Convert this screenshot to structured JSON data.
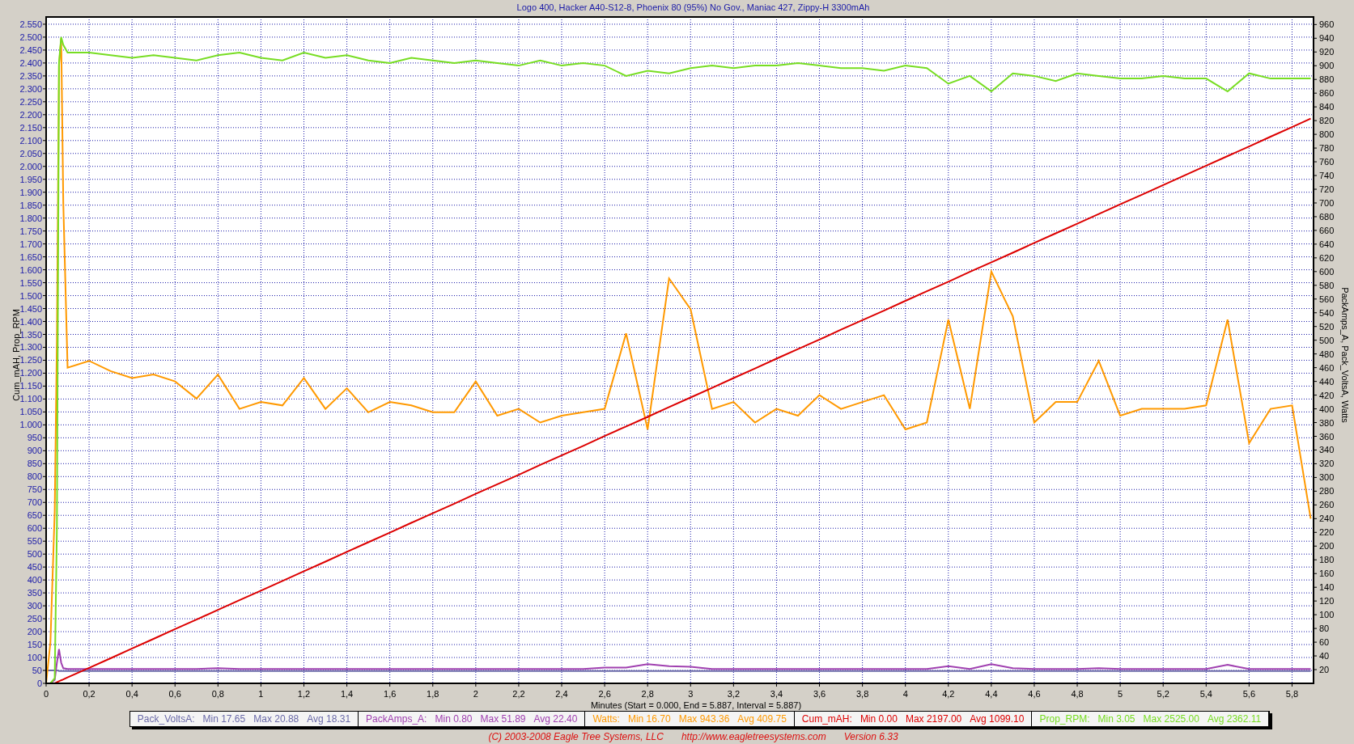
{
  "chart_data": {
    "type": "line",
    "title": "Logo 400, Hacker A40-S12-8, Phoenix 80 (95%) No Gov., Maniac 427, Zippy-H 3300mAh",
    "xlabel": "Minutes (Start = 0.000,  End = 5.887,  Interval =  5.887)",
    "ylabel": "Cum_mAH, Prop_RPM",
    "y2label": "PackAmps_A, Pack_VoltsA, Watts",
    "grid": true,
    "xlim": [
      0,
      5.9
    ],
    "ylim": [
      0,
      2578
    ],
    "y2lim": [
      0,
      971
    ],
    "x": [
      0,
      0.02,
      0.04,
      0.05,
      0.06,
      0.07,
      0.08,
      0.1,
      0.2,
      0.3,
      0.4,
      0.5,
      0.6,
      0.7,
      0.8,
      0.9,
      1.0,
      1.1,
      1.2,
      1.3,
      1.4,
      1.5,
      1.6,
      1.7,
      1.8,
      1.9,
      2.0,
      2.1,
      2.2,
      2.3,
      2.4,
      2.5,
      2.6,
      2.7,
      2.8,
      2.9,
      3.0,
      3.1,
      3.2,
      3.3,
      3.4,
      3.5,
      3.6,
      3.7,
      3.8,
      3.9,
      4.0,
      4.1,
      4.2,
      4.3,
      4.4,
      4.5,
      4.6,
      4.7,
      4.8,
      4.9,
      5.0,
      5.1,
      5.2,
      5.3,
      5.4,
      5.5,
      5.6,
      5.7,
      5.8,
      5.887
    ],
    "series": [
      {
        "name": "Pack_VoltsA:",
        "axis": "y2",
        "color": "#6a6aa8",
        "values": [
          19,
          19,
          19,
          19,
          18,
          18,
          18,
          18,
          18,
          18,
          18,
          18,
          18,
          18,
          18,
          18,
          18,
          18,
          18,
          18,
          18,
          18,
          18,
          18,
          18,
          18,
          18,
          18,
          18,
          18,
          18,
          18,
          18,
          18,
          18,
          18,
          18,
          18,
          18,
          18,
          18,
          18,
          18,
          18,
          18,
          18,
          18,
          18,
          18,
          18,
          18,
          18,
          18,
          18,
          18,
          18,
          18,
          18,
          18,
          18,
          18,
          18,
          18,
          18,
          18,
          18
        ]
      },
      {
        "name": "PackAmps_A:",
        "axis": "y2",
        "color": "#a040b0",
        "values": [
          0,
          0,
          5,
          30,
          50,
          30,
          22,
          21,
          21,
          21,
          21,
          21,
          21,
          21,
          22,
          21,
          21,
          21,
          21,
          21,
          21,
          21,
          21,
          21,
          21,
          21,
          21,
          21,
          21,
          21,
          21,
          21,
          23,
          23,
          28,
          25,
          24,
          21,
          21,
          21,
          21,
          21,
          21,
          21,
          21,
          21,
          21,
          21,
          25,
          21,
          28,
          22,
          21,
          21,
          21,
          22,
          21,
          21,
          21,
          21,
          21,
          27,
          21,
          21,
          21,
          21
        ]
      },
      {
        "name": "Watts:",
        "axis": "y2",
        "color": "#ff9900",
        "values": [
          0,
          60,
          250,
          500,
          900,
          940,
          700,
          460,
          470,
          455,
          445,
          450,
          440,
          415,
          450,
          400,
          410,
          405,
          445,
          400,
          430,
          395,
          410,
          405,
          395,
          395,
          440,
          390,
          400,
          380,
          390,
          395,
          400,
          510,
          370,
          590,
          545,
          400,
          410,
          380,
          400,
          390,
          420,
          400,
          410,
          420,
          370,
          380,
          530,
          400,
          600,
          535,
          380,
          410,
          410,
          470,
          390,
          400,
          400,
          400,
          405,
          530,
          350,
          400,
          405,
          240
        ]
      },
      {
        "name": "Cum_mAH:",
        "color": "#dd0000",
        "values": [
          0,
          0,
          0,
          4,
          8,
          12,
          15,
          23,
          60,
          97,
          135,
          172,
          210,
          247,
          284,
          322,
          359,
          396,
          434,
          471,
          509,
          546,
          583,
          621,
          658,
          695,
          733,
          770,
          807,
          845,
          882,
          919,
          957,
          994,
          1031,
          1069,
          1106,
          1143,
          1181,
          1218,
          1256,
          1293,
          1330,
          1368,
          1405,
          1442,
          1480,
          1517,
          1554,
          1592,
          1629,
          1666,
          1704,
          1741,
          1778,
          1816,
          1853,
          1890,
          1928,
          1965,
          2003,
          2040,
          2077,
          2115,
          2152,
          2185
        ]
      },
      {
        "name": "Prop_RPM:",
        "color": "#77dd22",
        "values": [
          0,
          0,
          20,
          600,
          2400,
          2500,
          2470,
          2440,
          2440,
          2430,
          2420,
          2430,
          2420,
          2410,
          2430,
          2440,
          2420,
          2410,
          2440,
          2420,
          2430,
          2410,
          2400,
          2420,
          2410,
          2400,
          2410,
          2400,
          2390,
          2410,
          2390,
          2400,
          2390,
          2350,
          2370,
          2360,
          2380,
          2390,
          2380,
          2390,
          2390,
          2400,
          2390,
          2380,
          2380,
          2370,
          2390,
          2380,
          2320,
          2350,
          2290,
          2360,
          2350,
          2330,
          2360,
          2350,
          2340,
          2340,
          2350,
          2340,
          2340,
          2290,
          2360,
          2340,
          2340,
          2340
        ]
      }
    ],
    "xticks": [
      {
        "value": 0,
        "label": "0"
      },
      {
        "value": 0.2,
        "label": "0,2"
      },
      {
        "value": 0.4,
        "label": "0,4"
      },
      {
        "value": 0.6,
        "label": "0,6"
      },
      {
        "value": 0.8,
        "label": "0,8"
      },
      {
        "value": 1,
        "label": "1"
      },
      {
        "value": 1.2,
        "label": "1,2"
      },
      {
        "value": 1.4,
        "label": "1,4"
      },
      {
        "value": 1.6,
        "label": "1,6"
      },
      {
        "value": 1.8,
        "label": "1,8"
      },
      {
        "value": 2,
        "label": "2"
      },
      {
        "value": 2.2,
        "label": "2,2"
      },
      {
        "value": 2.4,
        "label": "2,4"
      },
      {
        "value": 2.6,
        "label": "2,6"
      },
      {
        "value": 2.8,
        "label": "2,8"
      },
      {
        "value": 3,
        "label": "3"
      },
      {
        "value": 3.2,
        "label": "3,2"
      },
      {
        "value": 3.4,
        "label": "3,4"
      },
      {
        "value": 3.6,
        "label": "3,6"
      },
      {
        "value": 3.8,
        "label": "3,8"
      },
      {
        "value": 4,
        "label": "4"
      },
      {
        "value": 4.2,
        "label": "4,2"
      },
      {
        "value": 4.4,
        "label": "4,4"
      },
      {
        "value": 4.6,
        "label": "4,6"
      },
      {
        "value": 4.8,
        "label": "4,8"
      },
      {
        "value": 5,
        "label": "5"
      },
      {
        "value": 5.2,
        "label": "5,2"
      },
      {
        "value": 5.4,
        "label": "5,4"
      },
      {
        "value": 5.6,
        "label": "5,6"
      },
      {
        "value": 5.8,
        "label": "5,8"
      }
    ],
    "yticks": [
      {
        "value": 0,
        "label": "0"
      },
      {
        "value": 50,
        "label": "50"
      },
      {
        "value": 100,
        "label": "100"
      },
      {
        "value": 150,
        "label": "150"
      },
      {
        "value": 200,
        "label": "200"
      },
      {
        "value": 250,
        "label": "250"
      },
      {
        "value": 300,
        "label": "300"
      },
      {
        "value": 350,
        "label": "350"
      },
      {
        "value": 400,
        "label": "400"
      },
      {
        "value": 450,
        "label": "450"
      },
      {
        "value": 500,
        "label": "500"
      },
      {
        "value": 550,
        "label": "550"
      },
      {
        "value": 600,
        "label": "600"
      },
      {
        "value": 650,
        "label": "650"
      },
      {
        "value": 700,
        "label": "700"
      },
      {
        "value": 750,
        "label": "750"
      },
      {
        "value": 800,
        "label": "800"
      },
      {
        "value": 850,
        "label": "850"
      },
      {
        "value": 900,
        "label": "900"
      },
      {
        "value": 950,
        "label": "950"
      },
      {
        "value": 1000,
        "label": "1.000"
      },
      {
        "value": 1050,
        "label": "1.050"
      },
      {
        "value": 1100,
        "label": "1.100"
      },
      {
        "value": 1150,
        "label": "1.150"
      },
      {
        "value": 1200,
        "label": "1.200"
      },
      {
        "value": 1250,
        "label": "1.250"
      },
      {
        "value": 1300,
        "label": "1.300"
      },
      {
        "value": 1350,
        "label": "1.350"
      },
      {
        "value": 1400,
        "label": "1.400"
      },
      {
        "value": 1450,
        "label": "1.450"
      },
      {
        "value": 1500,
        "label": "1.500"
      },
      {
        "value": 1550,
        "label": "1.550"
      },
      {
        "value": 1600,
        "label": "1.600"
      },
      {
        "value": 1650,
        "label": "1.650"
      },
      {
        "value": 1700,
        "label": "1.700"
      },
      {
        "value": 1750,
        "label": "1.750"
      },
      {
        "value": 1800,
        "label": "1.800"
      },
      {
        "value": 1850,
        "label": "1.850"
      },
      {
        "value": 1900,
        "label": "1.900"
      },
      {
        "value": 1950,
        "label": "1.950"
      },
      {
        "value": 2000,
        "label": "2.000"
      },
      {
        "value": 2050,
        "label": "2.050"
      },
      {
        "value": 2100,
        "label": "2.100"
      },
      {
        "value": 2150,
        "label": "2.150"
      },
      {
        "value": 2200,
        "label": "2.200"
      },
      {
        "value": 2250,
        "label": "2.250"
      },
      {
        "value": 2300,
        "label": "2.300"
      },
      {
        "value": 2350,
        "label": "2.350"
      },
      {
        "value": 2400,
        "label": "2.400"
      },
      {
        "value": 2450,
        "label": "2.450"
      },
      {
        "value": 2500,
        "label": "2.500"
      },
      {
        "value": 2550,
        "label": "2.550"
      }
    ],
    "y2ticks": [
      20,
      40,
      60,
      80,
      100,
      120,
      140,
      160,
      180,
      200,
      220,
      240,
      260,
      280,
      300,
      320,
      340,
      360,
      380,
      400,
      420,
      440,
      460,
      480,
      500,
      520,
      540,
      560,
      580,
      600,
      620,
      640,
      660,
      680,
      700,
      720,
      740,
      760,
      780,
      800,
      820,
      840,
      860,
      880,
      900,
      920,
      940,
      960
    ]
  },
  "legend_stats": [
    {
      "min": "Min 17.65",
      "max": "Max 20.88",
      "avg": "Avg 18.31"
    },
    {
      "min": "Min 0.80",
      "max": "Max 51.89",
      "avg": "Avg 22.40"
    },
    {
      "min": "Min 16.70",
      "max": "Max 943.36",
      "avg": "Avg 409.75"
    },
    {
      "min": "Min 0.00",
      "max": "Max 2197.00",
      "avg": "Avg 1099.10"
    },
    {
      "min": "Min 3.05",
      "max": "Max 2525.00",
      "avg": "Avg 2362.11"
    }
  ],
  "footer": {
    "copyright": "(C) 2003-2008 Eagle Tree Systems, LLC",
    "website": "http://www.eagletreesystems.com",
    "version": "Version 6.33"
  }
}
